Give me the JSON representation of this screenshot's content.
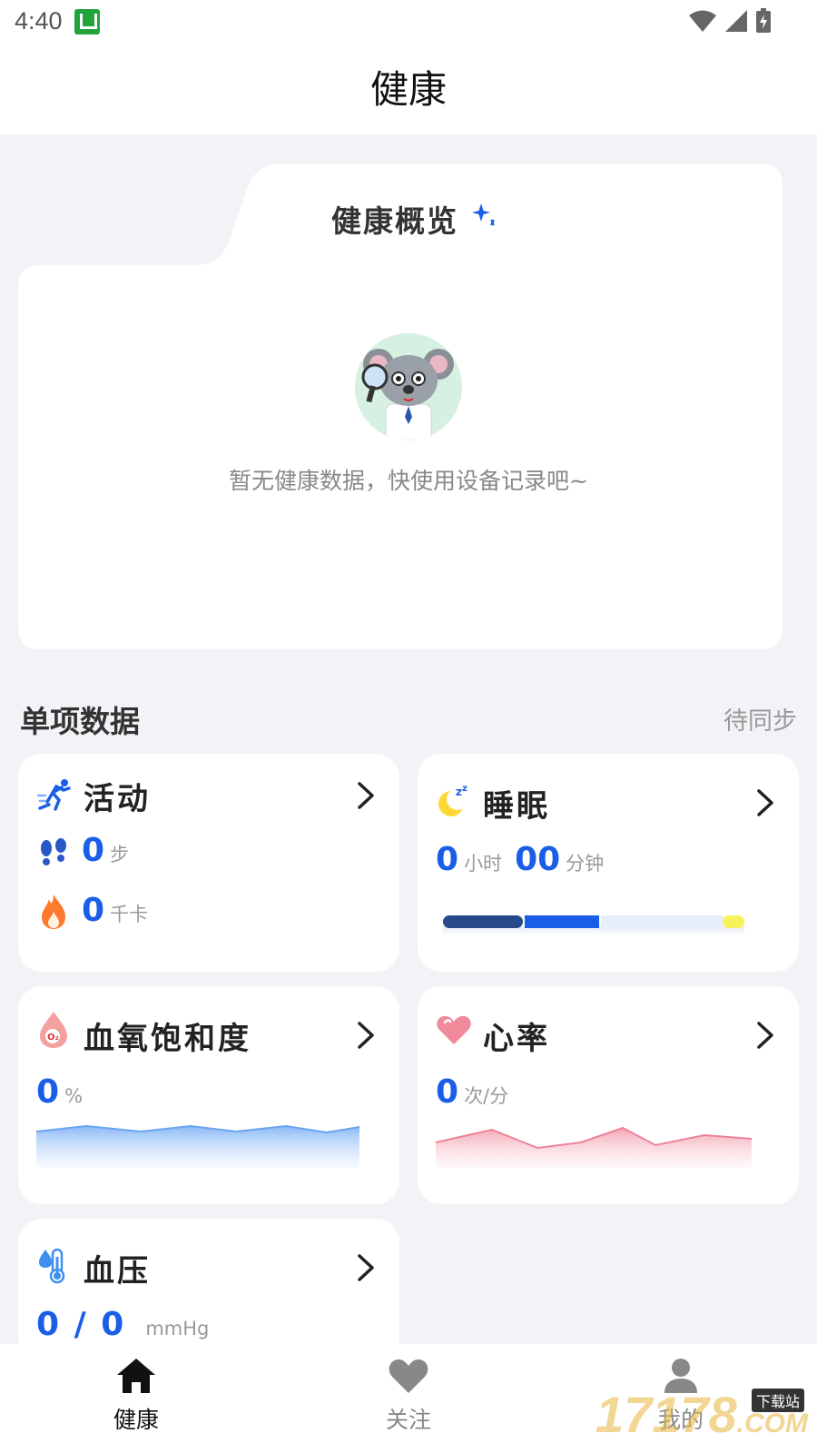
{
  "status_bar": {
    "time": "4:40"
  },
  "header": {
    "title": "健康"
  },
  "overview": {
    "title": "健康概览",
    "empty_text": "暂无健康数据，快使用设备记录吧~"
  },
  "section": {
    "title": "单项数据",
    "sync_status": "待同步"
  },
  "cards": {
    "activity": {
      "title": "活动",
      "steps_value": "0",
      "steps_unit": "步",
      "calories_value": "0",
      "calories_unit": "千卡"
    },
    "sleep": {
      "title": "睡眠",
      "hours_value": "0",
      "hours_unit": "小时",
      "minutes_value": "00",
      "minutes_unit": "分钟"
    },
    "spo2": {
      "title": "血氧饱和度",
      "value": "0",
      "unit": "%"
    },
    "heart_rate": {
      "title": "心率",
      "value": "0",
      "unit": "次/分"
    },
    "blood_pressure": {
      "title": "血压",
      "value": "0 / 0",
      "unit": "mmHg"
    }
  },
  "bottom_nav": [
    {
      "label": "健康",
      "icon": "home-icon",
      "active": true
    },
    {
      "label": "关注",
      "icon": "heart-icon",
      "active": false
    },
    {
      "label": "我的",
      "icon": "person-icon",
      "active": false
    }
  ],
  "watermark": {
    "text": "17178",
    "tag": "下载站",
    "suffix": ".COM"
  },
  "colors": {
    "accent": "#1a5ee8",
    "background": "#f2f2f7",
    "card": "#ffffff",
    "muted": "#999999"
  }
}
